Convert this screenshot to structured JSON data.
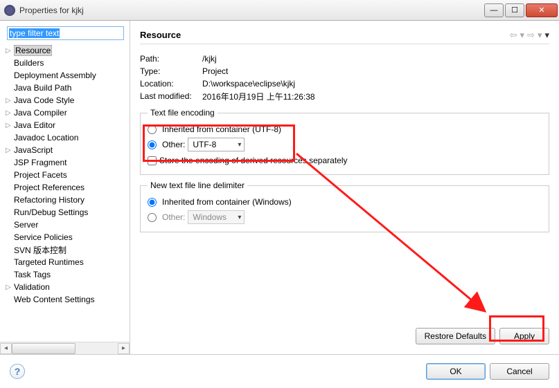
{
  "window": {
    "title": "Properties for kjkj"
  },
  "sidebar": {
    "filter_placeholder": "type filter text",
    "items": [
      {
        "label": "Resource",
        "expandable": true,
        "selected": true
      },
      {
        "label": "Builders"
      },
      {
        "label": "Deployment Assembly"
      },
      {
        "label": "Java Build Path"
      },
      {
        "label": "Java Code Style",
        "expandable": true
      },
      {
        "label": "Java Compiler",
        "expandable": true
      },
      {
        "label": "Java Editor",
        "expandable": true
      },
      {
        "label": "Javadoc Location"
      },
      {
        "label": "JavaScript",
        "expandable": true
      },
      {
        "label": "JSP Fragment"
      },
      {
        "label": "Project Facets"
      },
      {
        "label": "Project References"
      },
      {
        "label": "Refactoring History"
      },
      {
        "label": "Run/Debug Settings"
      },
      {
        "label": "Server"
      },
      {
        "label": "Service Policies"
      },
      {
        "label": "SVN 版本控制"
      },
      {
        "label": "Targeted Runtimes"
      },
      {
        "label": "Task Tags"
      },
      {
        "label": "Validation",
        "expandable": true
      },
      {
        "label": "Web Content Settings"
      }
    ]
  },
  "main": {
    "heading": "Resource",
    "info": {
      "path_label": "Path:",
      "path_value": "/kjkj",
      "type_label": "Type:",
      "type_value": "Project",
      "location_label": "Location:",
      "location_value": "D:\\workspace\\eclipse\\kjkj",
      "modified_label": "Last modified:",
      "modified_value": "2016年10月19日 上午11:26:38"
    },
    "encoding": {
      "legend": "Text file encoding",
      "inherited_label": "Inherited from container (UTF-8)",
      "other_label": "Other:",
      "other_value": "UTF-8",
      "store_label": "Store the encoding of derived resources separately"
    },
    "delimiter": {
      "legend": "New text file line delimiter",
      "inherited_label": "Inherited from container (Windows)",
      "other_label": "Other:",
      "other_value": "Windows"
    },
    "buttons": {
      "restore": "Restore Defaults",
      "apply": "Apply"
    }
  },
  "footer": {
    "ok": "OK",
    "cancel": "Cancel"
  }
}
